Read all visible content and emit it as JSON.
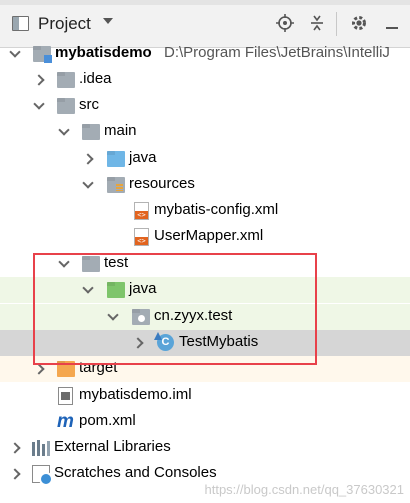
{
  "toolbar": {
    "title": "Project",
    "buttons": [
      "crosshair-icon",
      "collapse-icon",
      "gear-icon",
      "minimize-icon"
    ]
  },
  "tree": {
    "root": {
      "name": "mybatisdemo",
      "path": "D:\\Program Files\\JetBrains\\IntelliJ"
    },
    "idea": ".idea",
    "src": "src",
    "main": "main",
    "main_java": "java",
    "resources": "resources",
    "config_xml": "mybatis-config.xml",
    "mapper_xml": "UserMapper.xml",
    "test": "test",
    "test_java": "java",
    "package": "cn.zyyx.test",
    "test_class": "TestMybatis",
    "target": "target",
    "iml": "mybatisdemo.iml",
    "pom": "pom.xml",
    "external_libraries": "External Libraries",
    "scratches": "Scratches and Consoles"
  },
  "maven_glyph": "m",
  "watermark": "https://blog.csdn.net/qq_37630321",
  "colors": {
    "selection_gray": "#d6d6d6",
    "test_green": "#eff7e6",
    "annotation_red": "#e8414a"
  }
}
